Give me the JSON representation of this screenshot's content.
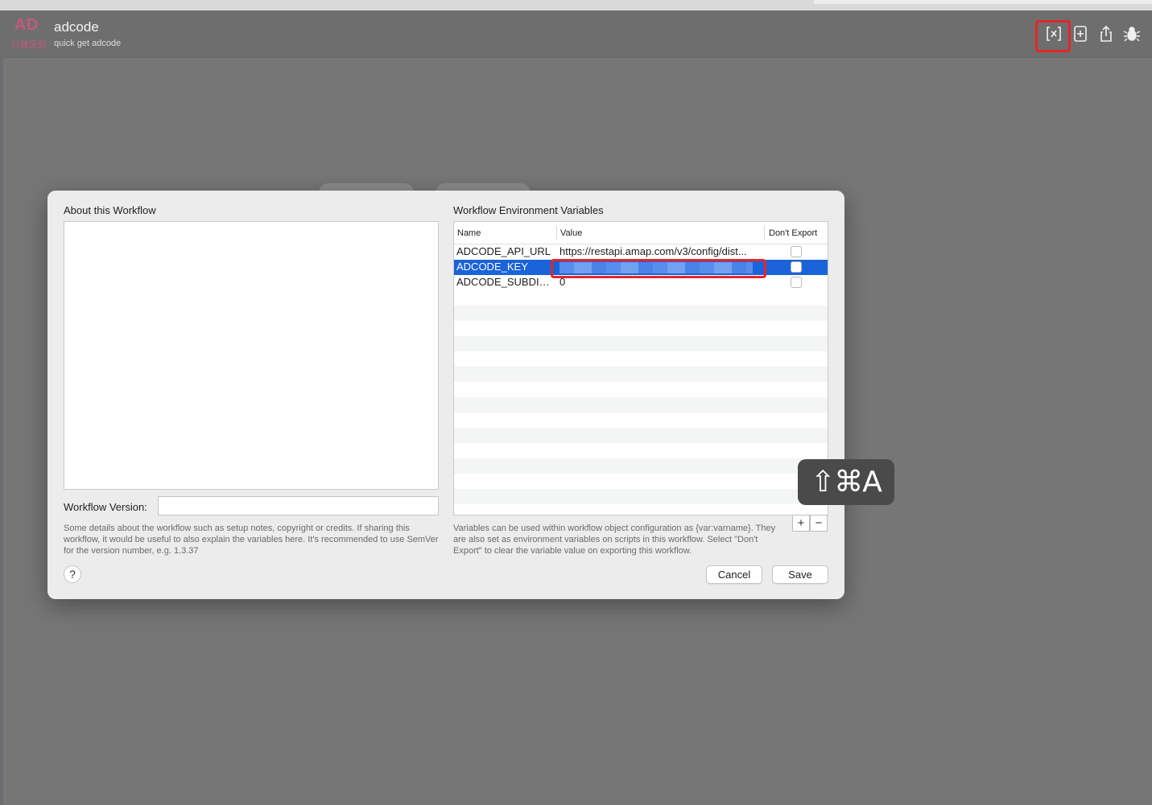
{
  "header": {
    "logo_text": "AD",
    "logo_subtext": "行政区划",
    "workflow_name": "adcode",
    "workflow_subtitle": "quick get adcode",
    "toolbar": [
      {
        "name": "variables-icon",
        "glyph": "[𝑥]"
      },
      {
        "name": "add-object-icon",
        "glyph": "⊞"
      },
      {
        "name": "share-icon",
        "glyph": "⇪"
      },
      {
        "name": "debug-icon",
        "glyph": "🐞"
      }
    ]
  },
  "dialog": {
    "about_title": "About this Workflow",
    "about_value": "",
    "version_label": "Workflow Version:",
    "version_value": "",
    "about_help": "Some details about the workflow such as setup notes, copyright or credits. If sharing this workflow, it would be useful to also explain the variables here. It's recommended to use SemVer for the version number, e.g. 1.3.37",
    "help_label": "?",
    "env_title": "Workflow Environment Variables",
    "columns": [
      "Name",
      "Value",
      "Don't Export"
    ],
    "rows": [
      {
        "name": "ADCODE_API_URL",
        "value": "https://restapi.amap.com/v3/config/dist...",
        "dont_export": false,
        "selected": false
      },
      {
        "name": "ADCODE_KEY",
        "value": "",
        "dont_export": false,
        "selected": true
      },
      {
        "name": "ADCODE_SUBDIS...",
        "value": "0",
        "dont_export": false,
        "selected": false
      }
    ],
    "add_label": "+",
    "remove_label": "−",
    "env_help": "Variables can be used within workflow object configuration as {var:varname}. They are also set as environment variables on scripts in this workflow. Select \"Don't Export\" to clear the variable value on exporting this workflow.",
    "cancel_label": "Cancel",
    "save_label": "Save"
  },
  "keystroke": "⇧⌘A",
  "colors": {
    "selection": "#1a63d8",
    "highlight": "#e3262a",
    "logo": "#c8577f"
  }
}
